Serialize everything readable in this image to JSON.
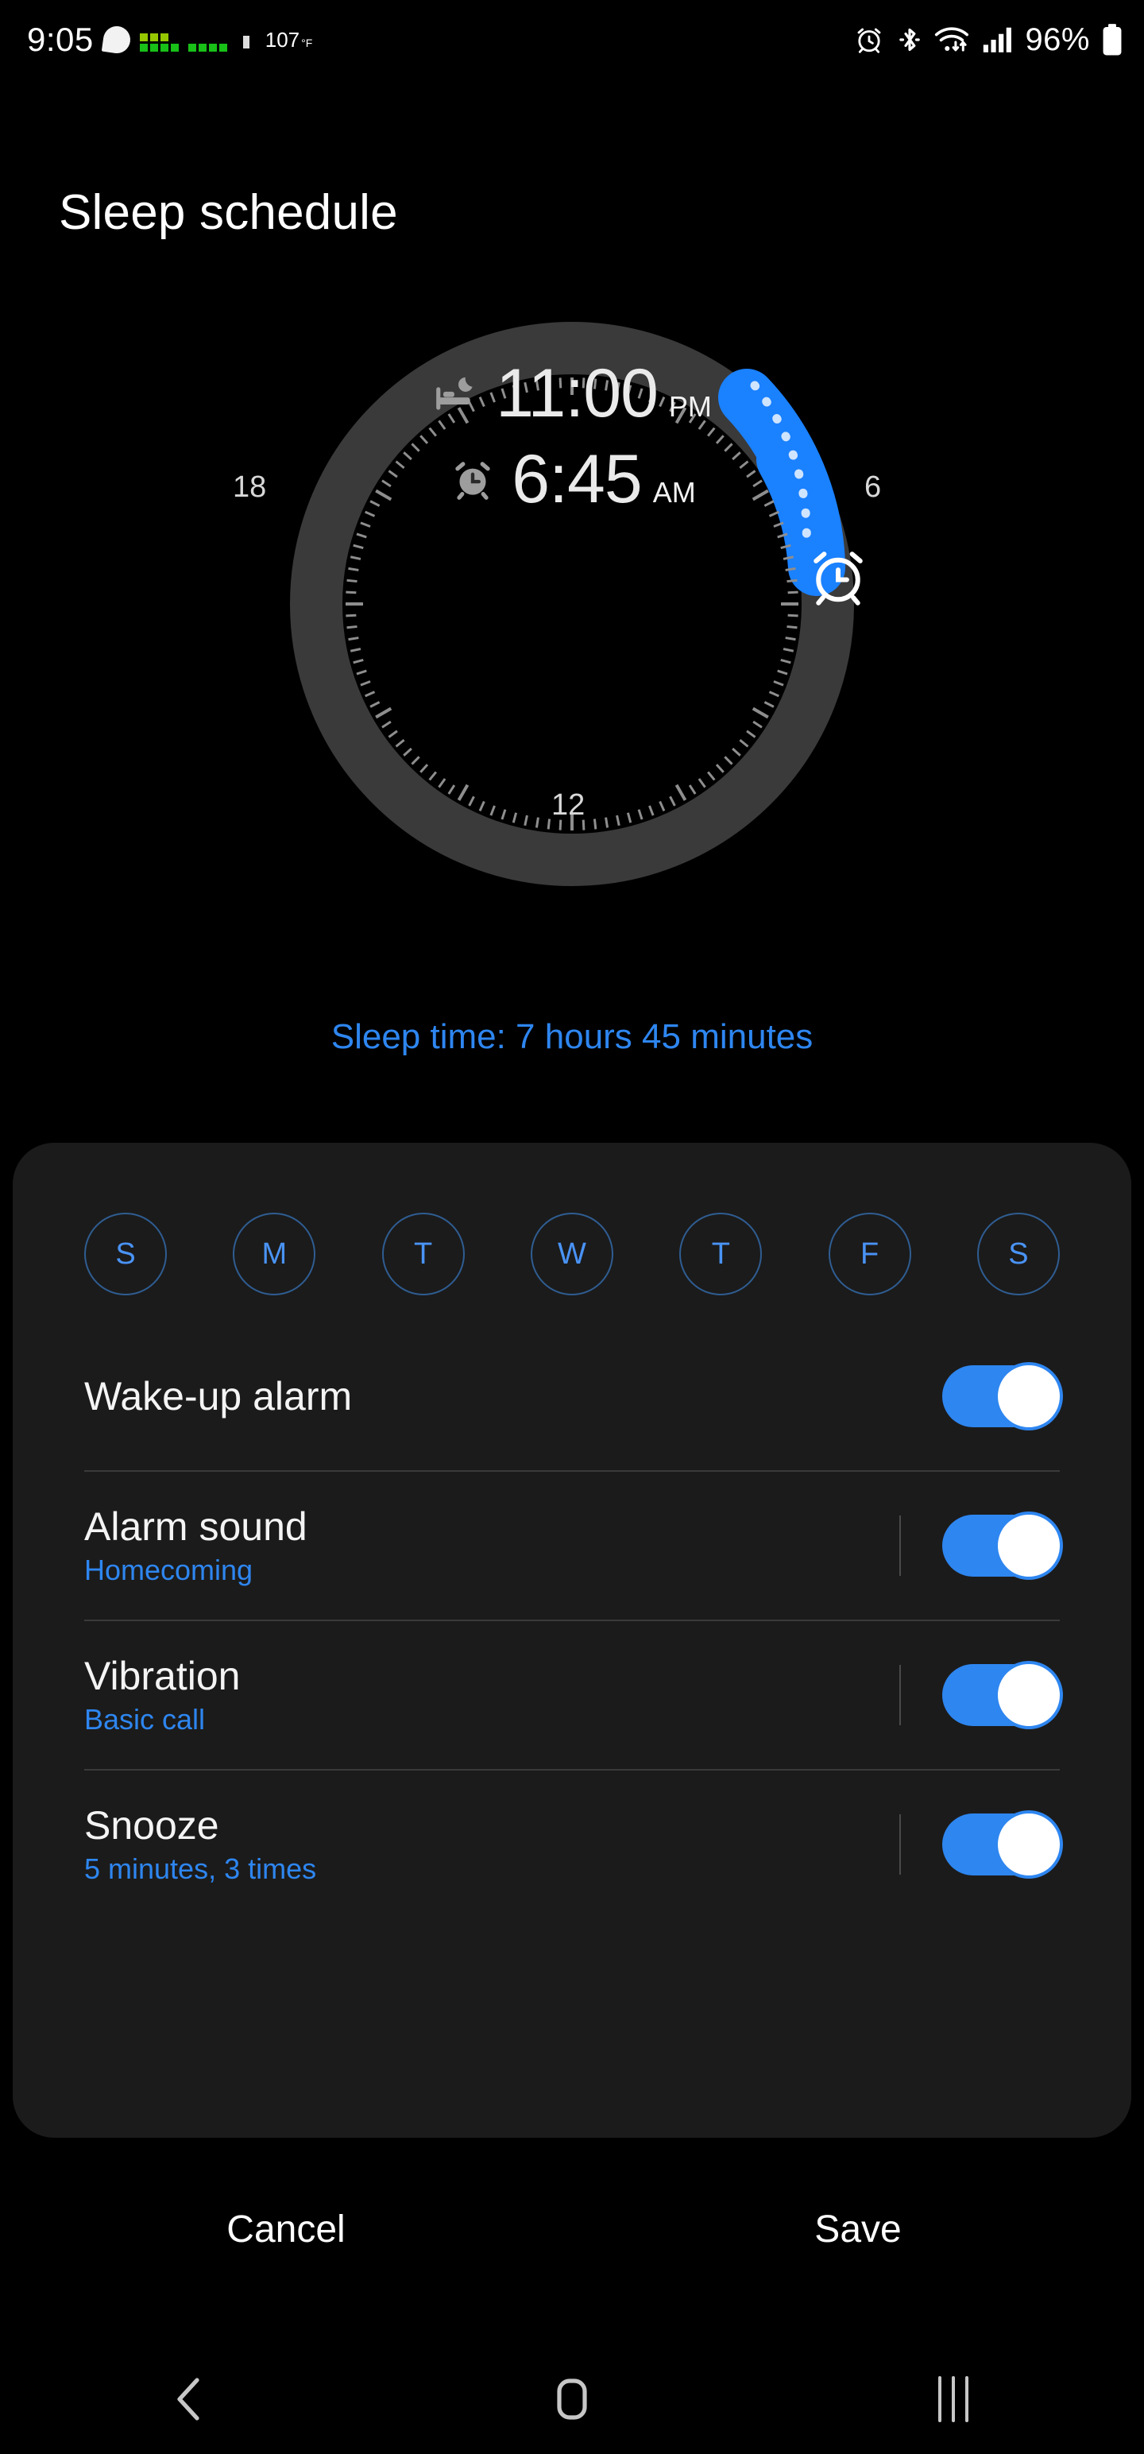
{
  "status_bar": {
    "clock": "9:05",
    "temperature": "107",
    "temperature_unit": "°F",
    "battery_percent": "96%",
    "icons": [
      "message-bubble-icon",
      "signal-dots-icon",
      "cpu-icon",
      "alarm-icon",
      "bluetooth-icon",
      "wifi-icon",
      "cellular-signal-icon",
      "battery-icon"
    ]
  },
  "header": {
    "title": "Sleep schedule"
  },
  "dial": {
    "bedtime_icon": "bed-moon-icon",
    "bedtime": "11:00",
    "bedtime_meridiem": "PM",
    "waketime_icon": "alarm-clock-icon",
    "waketime": "6:45",
    "waketime_meridiem": "AM",
    "hour_labels": {
      "left": "18",
      "right": "6",
      "bottom": "12"
    },
    "handle_icon": "alarm-clock-handle-icon",
    "accent_color": "#1a81ff",
    "track_color": "#3a3a3a"
  },
  "sleep_summary": {
    "text": "Sleep time: 7 hours 45 minutes",
    "color": "#2e86f0"
  },
  "days": [
    {
      "label": "S",
      "name": "sunday",
      "selected": false
    },
    {
      "label": "M",
      "name": "monday",
      "selected": false
    },
    {
      "label": "T",
      "name": "tuesday",
      "selected": false
    },
    {
      "label": "W",
      "name": "wednesday",
      "selected": false
    },
    {
      "label": "T",
      "name": "thursday",
      "selected": false
    },
    {
      "label": "F",
      "name": "friday",
      "selected": false
    },
    {
      "label": "S",
      "name": "saturday",
      "selected": false
    }
  ],
  "settings": [
    {
      "title": "Wake-up alarm",
      "subtitle": "",
      "toggle_on": true,
      "has_divider": false
    },
    {
      "title": "Alarm sound",
      "subtitle": "Homecoming",
      "toggle_on": true,
      "has_divider": true
    },
    {
      "title": "Vibration",
      "subtitle": "Basic call",
      "toggle_on": true,
      "has_divider": true
    },
    {
      "title": "Snooze",
      "subtitle": "5 minutes, 3 times",
      "toggle_on": true,
      "has_divider": true
    }
  ],
  "actions": {
    "cancel_label": "Cancel",
    "save_label": "Save"
  },
  "navbar": {
    "back_icon": "back-chevron-icon",
    "home_icon": "home-square-icon",
    "recents_icon": "recents-bars-icon"
  }
}
